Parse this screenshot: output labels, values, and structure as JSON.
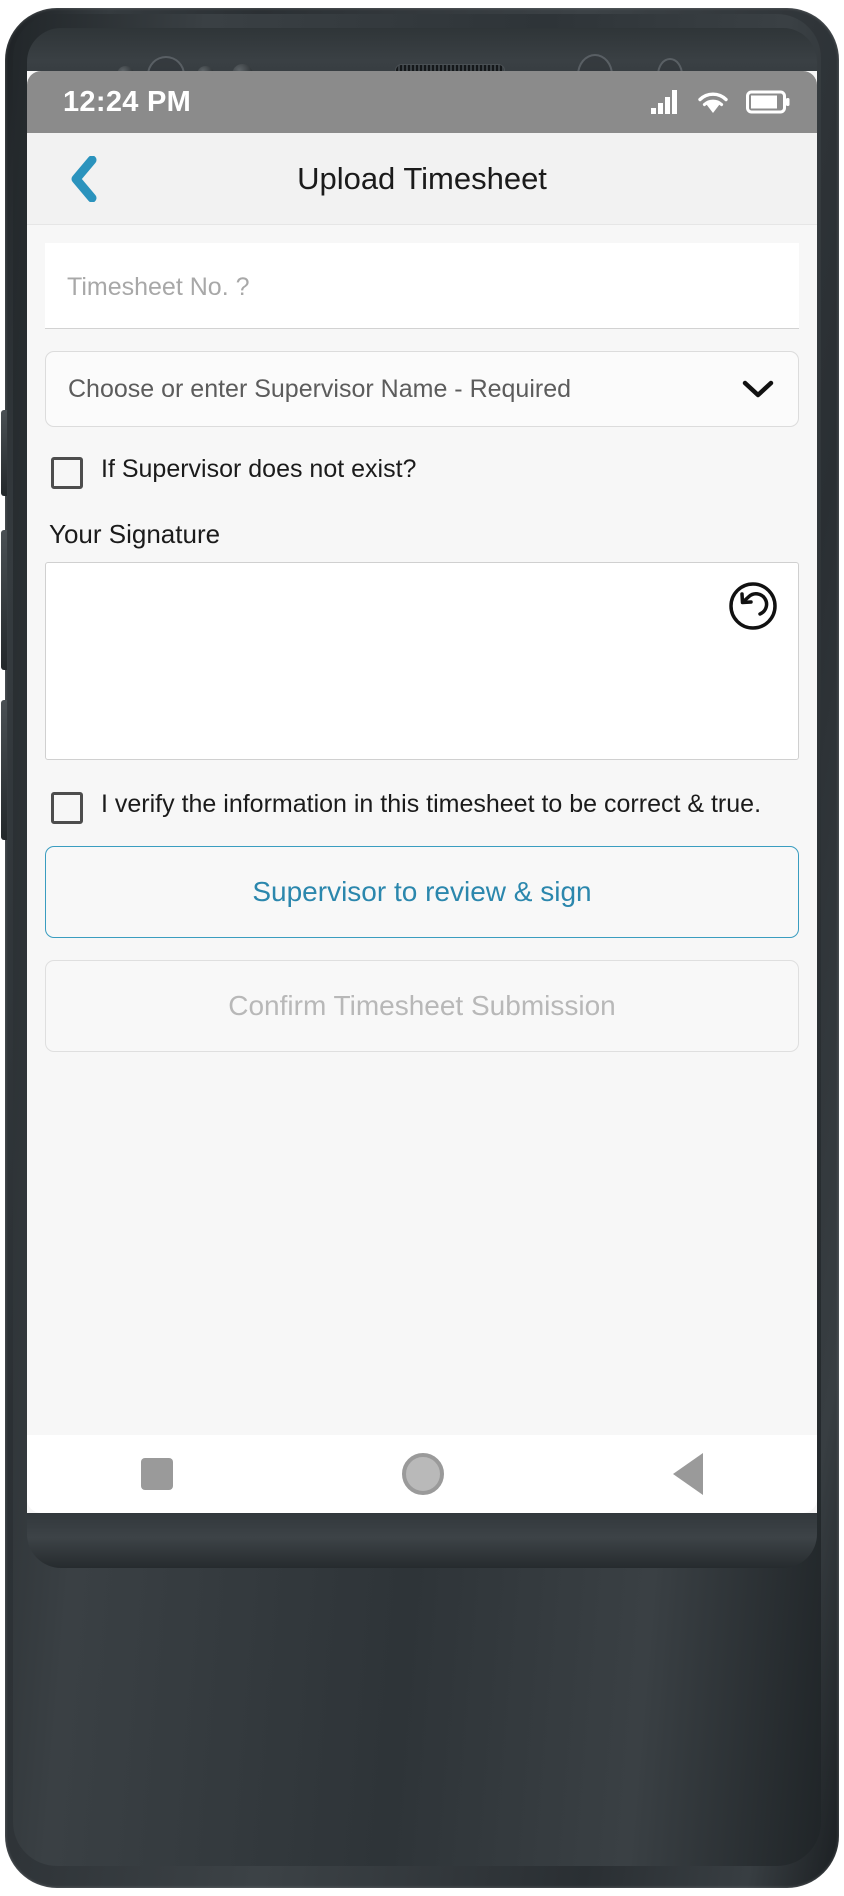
{
  "statusbar": {
    "time": "12:24 PM",
    "icons": [
      "signal-icon",
      "wifi-icon",
      "battery-icon"
    ]
  },
  "appbar": {
    "back_icon": "chevron-left-icon",
    "title": "Upload Timesheet",
    "accent_color": "#2b93bd"
  },
  "form": {
    "timesheet_no": {
      "placeholder": "Timesheet No. ?",
      "value": ""
    },
    "supervisor_select": {
      "placeholder": "Choose or enter Supervisor Name - Required",
      "value": "",
      "chevron_icon": "chevron-down-icon"
    },
    "supervisor_missing_checkbox": {
      "label": "If Supervisor does not exist?",
      "checked": false
    },
    "signature": {
      "label": "Your Signature",
      "undo_icon": "undo-circle-icon"
    },
    "verify_checkbox": {
      "label": "I verify the information in this timesheet to be correct & true.",
      "checked": false
    },
    "buttons": {
      "review_sign": "Supervisor to review & sign",
      "confirm_submission": "Confirm Timesheet Submission"
    }
  },
  "navbar": {
    "recents_icon": "square-icon",
    "home_icon": "circle-icon",
    "back_icon": "triangle-back-icon"
  }
}
